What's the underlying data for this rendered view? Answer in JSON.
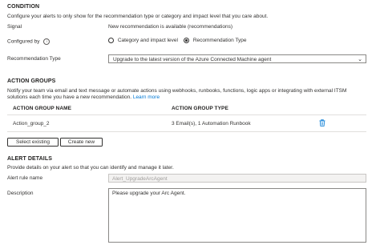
{
  "condition": {
    "heading": "CONDITION",
    "description": "Configure your alerts to only show for the recommendation type or category and impact level that you care about.",
    "signal_label": "Signal",
    "signal_value": "New recommendation is available (recommendations)",
    "configured_by_label": "Configured by",
    "option_category": "Category and impact level",
    "option_type": "Recommendation Type",
    "selected_option": "Recommendation Type",
    "rec_type_label": "Recommendation Type",
    "rec_type_value": "Upgrade to the latest version of the Azure Connected Machine agent"
  },
  "action_groups": {
    "heading": "ACTION GROUPS",
    "description_line1": "Notify your team via email and text message or automate actions using webhooks, runbooks, functions, logic apps or integrating with external ITSM",
    "description_line2": "solutions each time you have a new recommendation.",
    "learn_more": "Learn more",
    "col_name": "ACTION GROUP NAME",
    "col_type": "ACTION GROUP TYPE",
    "rows": [
      {
        "name": "Action_group_2",
        "type": "3 Email(s), 1 Automation Runbook"
      }
    ],
    "select_existing": "Select existing",
    "create_new": "Create new"
  },
  "alert_details": {
    "heading": "ALERT DETAILS",
    "description": "Provide details on your alert so that you can identify and manage it later.",
    "rule_name_label": "Alert rule name",
    "rule_name_value": "Alert_UpgradeArcAgent",
    "desc_label": "Description",
    "desc_value": "Please upgrade your Arc Agent."
  },
  "colors": {
    "accent": "#0078d4",
    "text": "#323130",
    "border": "#8a8886"
  }
}
